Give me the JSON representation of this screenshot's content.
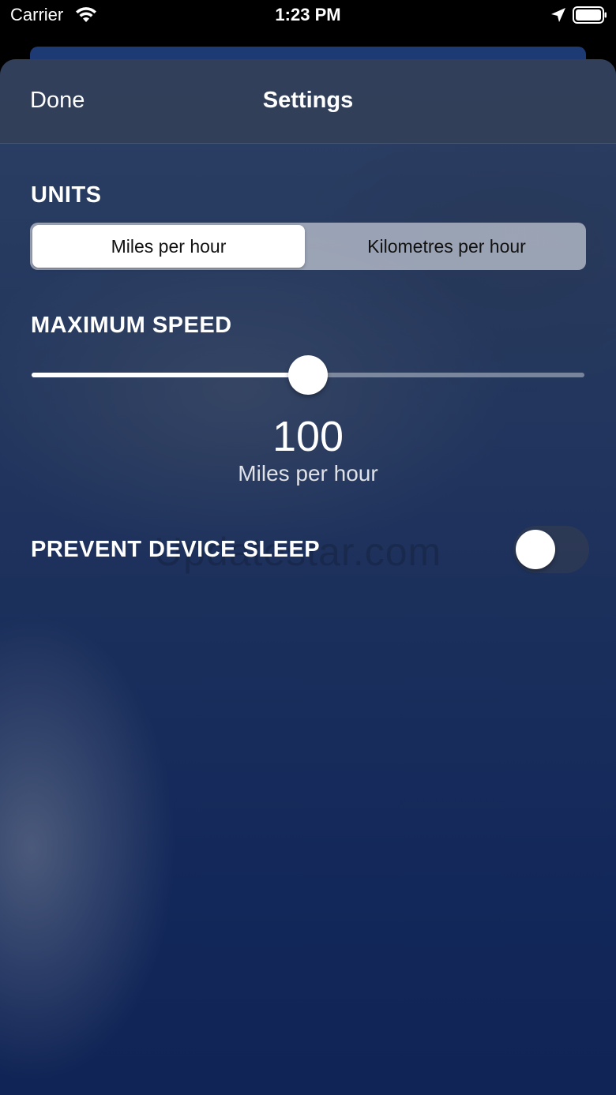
{
  "status_bar": {
    "carrier": "Carrier",
    "time": "1:23 PM"
  },
  "nav": {
    "done_label": "Done",
    "title": "Settings"
  },
  "units": {
    "label": "UNITS",
    "options": [
      "Miles per hour",
      "Kilometres per hour"
    ],
    "selected": "Miles per hour"
  },
  "max_speed": {
    "label": "MAXIMUM SPEED",
    "value": "100",
    "unit": "Miles per hour",
    "slider_fraction": 0.5
  },
  "prevent_sleep": {
    "label": "PREVENT DEVICE SLEEP",
    "enabled": false
  },
  "watermark": "Updatestar.com",
  "icons": {
    "wifi": "wifi-icon",
    "location": "location-arrow-icon",
    "battery": "battery-icon"
  },
  "colors": {
    "sheet_top": "#2c3f63",
    "sheet_bottom": "#102455",
    "accent": "#ffffff"
  }
}
